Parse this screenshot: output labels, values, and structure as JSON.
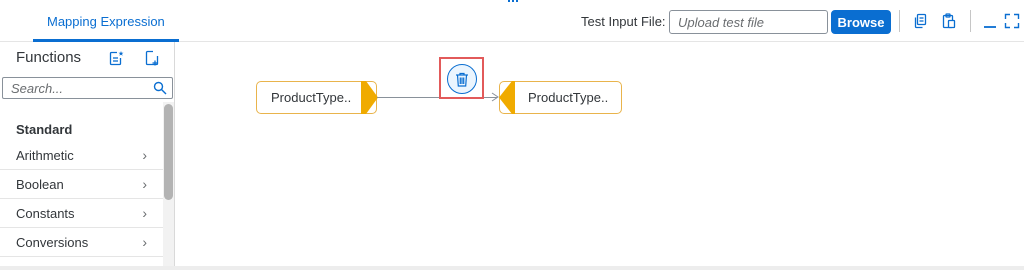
{
  "header": {
    "tab_label": "Mapping Expression",
    "test_input_label": "Test Input File:",
    "upload_placeholder": "Upload test file",
    "browse_label": "Browse"
  },
  "sidebar": {
    "title": "Functions",
    "search_placeholder": "Search...",
    "category": "Standard",
    "items": [
      {
        "label": "Arithmetic"
      },
      {
        "label": "Boolean"
      },
      {
        "label": "Constants"
      },
      {
        "label": "Conversions"
      }
    ]
  },
  "canvas": {
    "source_node": "ProductType..",
    "target_node": "ProductType.."
  },
  "icons": {
    "add_function": "add-function-icon",
    "new_function": "new-function-icon",
    "search": "search-icon",
    "copy": "copy-icon",
    "paste": "paste-icon",
    "minimize": "minimize-icon",
    "fullscreen": "fullscreen-icon",
    "delete": "trash-icon",
    "chevron": "chevron-right-icon"
  },
  "colors": {
    "accent": "#0a6ed1",
    "node_border": "#e9b44c",
    "node_port": "#f0ab00",
    "highlight": "#e25a5a"
  }
}
